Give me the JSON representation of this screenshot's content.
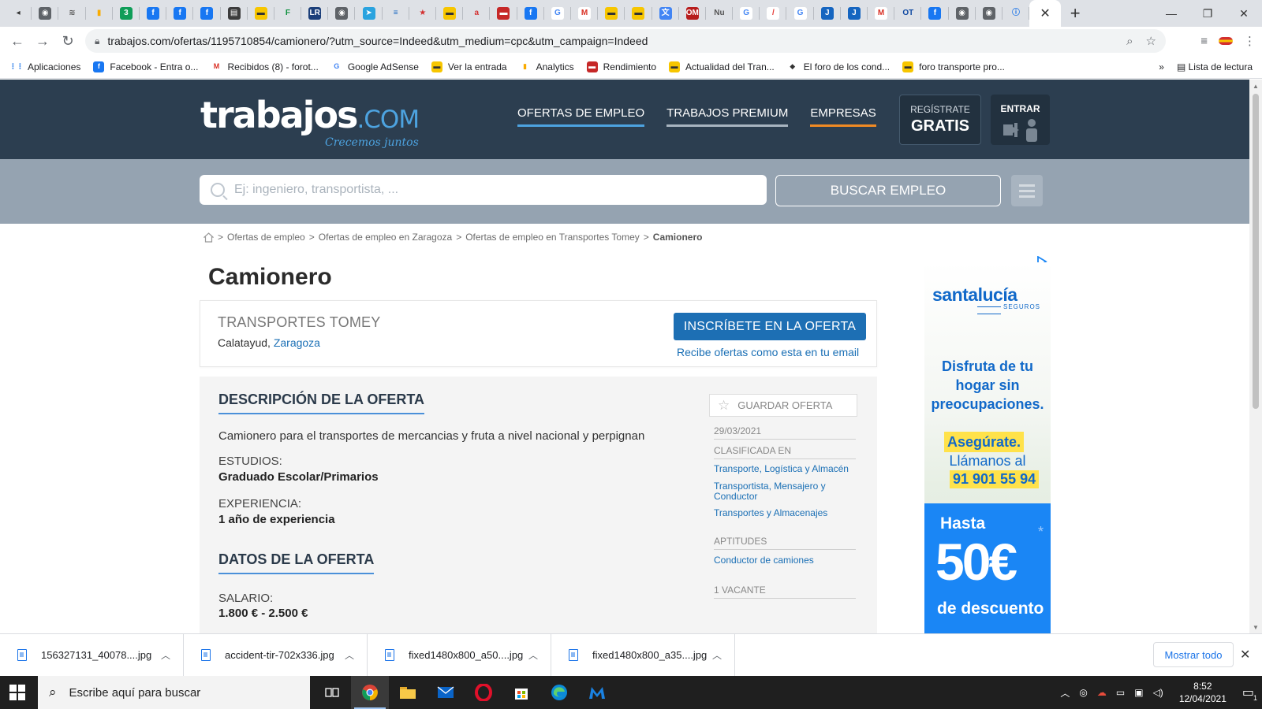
{
  "browser": {
    "tabs": [
      {
        "icon": "back-arrow-icon",
        "glyph": "◂",
        "bg": "#dee1e6",
        "fg": "#333"
      },
      {
        "icon": "globe-icon",
        "glyph": "◉",
        "bg": "#5f6368",
        "fg": "#fff"
      },
      {
        "icon": "wifi-icon",
        "glyph": "≋",
        "bg": "#dee1e6",
        "fg": "#555"
      },
      {
        "icon": "analytics-icon",
        "glyph": "▮",
        "bg": "#dee1e6",
        "fg": "#f9ab00"
      },
      {
        "icon": "circle-3-icon",
        "glyph": "3",
        "bg": "#0f9d58",
        "fg": "#fff"
      },
      {
        "icon": "facebook-icon",
        "glyph": "f",
        "bg": "#1877f2",
        "fg": "#fff"
      },
      {
        "icon": "facebook-icon",
        "glyph": "f",
        "bg": "#1877f2",
        "fg": "#fff"
      },
      {
        "icon": "facebook-icon",
        "glyph": "f",
        "bg": "#1877f2",
        "fg": "#fff"
      },
      {
        "icon": "newspaper-icon",
        "glyph": "▤",
        "bg": "#3c3c3c",
        "fg": "#fff"
      },
      {
        "icon": "truck-icon",
        "glyph": "▬",
        "bg": "#f7c600",
        "fg": "#333"
      },
      {
        "icon": "letter-f-icon",
        "glyph": "F",
        "bg": "#dee1e6",
        "fg": "#0a8f3c"
      },
      {
        "icon": "lr-icon",
        "glyph": "LR",
        "bg": "#1c3f7a",
        "fg": "#fff"
      },
      {
        "icon": "globe-icon",
        "glyph": "◉",
        "bg": "#5f6368",
        "fg": "#fff"
      },
      {
        "icon": "telegram-icon",
        "glyph": "➤",
        "bg": "#2aa3df",
        "fg": "#fff"
      },
      {
        "icon": "news-icon",
        "glyph": "≡",
        "bg": "#dee1e6",
        "fg": "#1565c0"
      },
      {
        "icon": "star-icon",
        "glyph": "★",
        "bg": "#dee1e6",
        "fg": "#d32f2f"
      },
      {
        "icon": "truck-icon",
        "glyph": "▬",
        "bg": "#f7c600",
        "fg": "#333"
      },
      {
        "icon": "letter-a-icon",
        "glyph": "a",
        "bg": "#dee1e6",
        "fg": "#d32f2f"
      },
      {
        "icon": "truck-red-icon",
        "glyph": "▬",
        "bg": "#c62828",
        "fg": "#fff"
      },
      {
        "icon": "facebook-icon",
        "glyph": "f",
        "bg": "#1877f2",
        "fg": "#fff"
      },
      {
        "icon": "google-icon",
        "glyph": "G",
        "bg": "#fff",
        "fg": "#4285f4"
      },
      {
        "icon": "gmail-icon",
        "glyph": "M",
        "bg": "#fff",
        "fg": "#d93025"
      },
      {
        "icon": "truck-icon",
        "glyph": "▬",
        "bg": "#f7c600",
        "fg": "#333"
      },
      {
        "icon": "truck-icon",
        "glyph": "▬",
        "bg": "#f7c600",
        "fg": "#333"
      },
      {
        "icon": "translate-icon",
        "glyph": "文",
        "bg": "#4285f4",
        "fg": "#fff"
      },
      {
        "icon": "om-icon",
        "glyph": "OM",
        "bg": "#b71c1c",
        "fg": "#fff"
      },
      {
        "icon": "text-nu-icon",
        "glyph": "Nu",
        "bg": "#dee1e6",
        "fg": "#555"
      },
      {
        "icon": "google-icon",
        "glyph": "G",
        "bg": "#fff",
        "fg": "#4285f4"
      },
      {
        "icon": "slash-icon",
        "glyph": "/",
        "bg": "#fff",
        "fg": "#e53935"
      },
      {
        "icon": "google-icon",
        "glyph": "G",
        "bg": "#fff",
        "fg": "#4285f4"
      },
      {
        "icon": "letter-j-icon",
        "glyph": "J",
        "bg": "#1565c0",
        "fg": "#fff"
      },
      {
        "icon": "letter-j-icon",
        "glyph": "J",
        "bg": "#1565c0",
        "fg": "#fff"
      },
      {
        "icon": "gmail-icon",
        "glyph": "M",
        "bg": "#fff",
        "fg": "#d93025"
      },
      {
        "icon": "ot-icon",
        "glyph": "OT",
        "bg": "#dee1e6",
        "fg": "#0d47a1"
      },
      {
        "icon": "facebook-icon",
        "glyph": "f",
        "bg": "#1877f2",
        "fg": "#fff"
      },
      {
        "icon": "globe-icon",
        "glyph": "◉",
        "bg": "#5f6368",
        "fg": "#fff"
      },
      {
        "icon": "globe-icon",
        "glyph": "◉",
        "bg": "#5f6368",
        "fg": "#fff"
      },
      {
        "icon": "info-icon",
        "glyph": "ⓘ",
        "bg": "#dee1e6",
        "fg": "#1a73e8"
      }
    ],
    "active_tab": {
      "icon": "trabajos-icon",
      "glyph": "t",
      "bg": "#2c3e50",
      "fg": "#fff"
    },
    "url": "trabajos.com/ofertas/1195710854/camionero/?utm_source=Indeed&utm_medium=cpc&utm_campaign=Indeed",
    "bookmarks": [
      {
        "label": "Aplicaciones",
        "icon": "apps-grid-icon",
        "glyph": "⋮⋮",
        "bg": "#fff",
        "fg": "#1a73e8"
      },
      {
        "label": "Facebook - Entra o...",
        "icon": "facebook-icon",
        "glyph": "f",
        "bg": "#1877f2",
        "fg": "#fff"
      },
      {
        "label": "Recibidos (8) - forot...",
        "icon": "gmail-icon",
        "glyph": "M",
        "bg": "#fff",
        "fg": "#d93025"
      },
      {
        "label": "Google AdSense",
        "icon": "google-icon",
        "glyph": "G",
        "bg": "#fff",
        "fg": "#4285f4"
      },
      {
        "label": "Ver la entrada",
        "icon": "truck-icon",
        "glyph": "▬",
        "bg": "#f7c600",
        "fg": "#333"
      },
      {
        "label": "Analytics",
        "icon": "analytics-icon",
        "glyph": "▮",
        "bg": "#fff",
        "fg": "#f9ab00"
      },
      {
        "label": "Rendimiento",
        "icon": "truck-red-icon",
        "glyph": "▬",
        "bg": "#c62828",
        "fg": "#fff"
      },
      {
        "label": "Actualidad del Tran...",
        "icon": "truck-icon",
        "glyph": "▬",
        "bg": "#f7c600",
        "fg": "#333"
      },
      {
        "label": "El foro de los cond...",
        "icon": "forum-icon",
        "glyph": "◆",
        "bg": "#fff",
        "fg": "#333"
      },
      {
        "label": "foro transporte pro...",
        "icon": "truck-icon",
        "glyph": "▬",
        "bg": "#f7c600",
        "fg": "#333"
      }
    ],
    "bookmarks_more": "»",
    "reading_list": "Lista de lectura"
  },
  "site": {
    "logo_main": "trabajos",
    "logo_com": ".COM",
    "logo_slogan": "Crecemos juntos",
    "nav": [
      "OFERTAS DE EMPLEO",
      "TRABAJOS PREMIUM",
      "EMPRESAS"
    ],
    "register_small": "REGÍSTRATE",
    "register_big": "GRATIS",
    "login": "ENTRAR",
    "search_placeholder": "Ej: ingeniero, transportista, ...",
    "search_button": "BUSCAR EMPLEO",
    "breadcrumb": [
      ">",
      "Ofertas de empleo",
      ">",
      "Ofertas de empleo en Zaragoza",
      ">",
      "Ofertas de empleo en Transportes Tomey",
      ">"
    ],
    "breadcrumb_current": "Camionero"
  },
  "job": {
    "title": "Camionero",
    "company": "TRANSPORTES TOMEY",
    "city": "Calatayud,",
    "province": "Zaragoza",
    "apply_button": "INSCRÍBETE EN LA OFERTA",
    "email_link": "Recibe ofertas como esta en tu email",
    "description_heading": "DESCRIPCIÓN DE LA OFERTA",
    "description": "Camionero para el transportes de mercancias y fruta a nivel nacional y perpignan",
    "studies_label": "ESTUDIOS:",
    "studies_value": "Graduado Escolar/Primarios",
    "experience_label": "EXPERIENCIA:",
    "experience_value": "1 año de experiencia",
    "data_heading": "DATOS DE LA OFERTA",
    "salary_label": "SALARIO:",
    "salary_value": "1.800 € - 2.500 €",
    "save_button": "GUARDAR OFERTA",
    "date": "29/03/2021",
    "classified_label": "CLASIFICADA EN",
    "categories": [
      "Transporte, Logística y Almacén",
      "Transportista, Mensajero y Conductor",
      "Transportes y Almacenajes"
    ],
    "skills_label": "APTITUDES",
    "skill": "Conductor de camiones",
    "vacancies": "1 VACANTE"
  },
  "ad": {
    "brand": "santalucía",
    "brand_sub": "SEGUROS",
    "line1": "Disfruta de tu",
    "line2": "hogar sin",
    "line3": "preocupaciones.",
    "line4": "Asegúrate.",
    "line5": "Llámanos al",
    "phone": "91 901 55 94",
    "hasta": "Hasta",
    "amount": "50€",
    "asterisk": "*",
    "descuento": "de descuento"
  },
  "downloads": {
    "items": [
      "156327131_40078....jpg",
      "accident-tir-702x336.jpg",
      "fixed1480x800_a50....jpg",
      "fixed1480x800_a35....jpg"
    ],
    "show_all": "Mostrar todo"
  },
  "taskbar": {
    "search_placeholder": "Escribe aquí para buscar",
    "time": "8:52",
    "date": "12/04/2021",
    "notifications": "1"
  },
  "colors": {
    "header": "#2c3e50",
    "search_band": "#95a3b1",
    "primary_blue": "#1d6fb4",
    "link_blue": "#1a6fb5",
    "nav_orange": "#f08a24"
  }
}
